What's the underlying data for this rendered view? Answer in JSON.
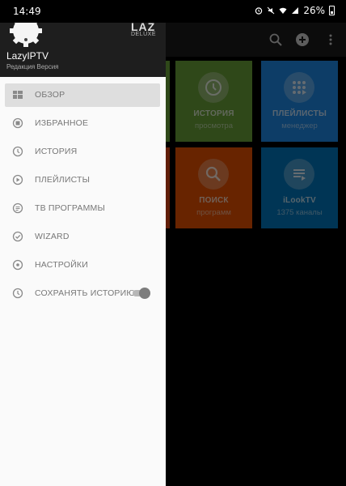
{
  "status_bar": {
    "time": "14:49",
    "battery": "26%"
  },
  "app_bar": {
    "actions": [
      "search-icon",
      "add-circle-icon",
      "more-vert-icon"
    ]
  },
  "drawer": {
    "logo_text": "LAZ",
    "logo_subtext": "DELUXE",
    "app_name": "LazyIPTV",
    "edition": "Редакция Версия",
    "items": [
      {
        "label": "ОБЗОР",
        "icon": "dashboard-icon",
        "selected": true
      },
      {
        "label": "ИЗБРАННОЕ",
        "icon": "favorites-icon"
      },
      {
        "label": "ИСТОРИЯ",
        "icon": "history-icon"
      },
      {
        "label": "ПЛЕЙЛИСТЫ",
        "icon": "playlists-icon"
      },
      {
        "label": "ТВ ПРОГРАММЫ",
        "icon": "tv-guide-icon"
      },
      {
        "label": "WIZARD",
        "icon": "wizard-icon"
      },
      {
        "label": "НАСТРОЙКИ",
        "icon": "settings-icon"
      },
      {
        "label": "СОХРАНЯТЬ ИСТОРИЮ",
        "icon": "history-icon",
        "toggle": true,
        "toggle_on": false
      }
    ]
  },
  "tiles": [
    {
      "title": "ИСТОРИЯ",
      "subtitle": "просмотра",
      "icon": "clock-icon",
      "color": "#689f38"
    },
    {
      "title": "ПЛЕЙЛИСТЫ",
      "subtitle": "менеджер",
      "icon": "playlist-icon",
      "color": "#1e88e5"
    },
    {
      "title": "ПОИСК",
      "subtitle": "программ",
      "icon": "search-icon",
      "color": "#e65100"
    },
    {
      "title": "iLookTV",
      "subtitle": "1375 каналы",
      "icon": "playlist-lines-icon",
      "color": "#0277bd"
    }
  ],
  "colors": {
    "tile_green_left": "#8bc34a",
    "tile_orange_left": "#e65100"
  }
}
